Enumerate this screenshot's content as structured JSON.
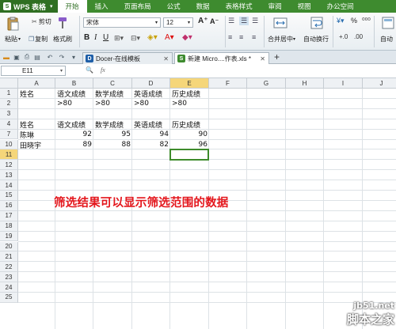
{
  "app": {
    "brand": "WPS 表格"
  },
  "menu": [
    "开始",
    "插入",
    "页面布局",
    "公式",
    "数据",
    "表格样式",
    "审阅",
    "视图",
    "办公空间"
  ],
  "ribbon": {
    "paste": "粘贴",
    "cut": "剪切",
    "copy": "复制",
    "format_painter": "格式刷",
    "font_name": "宋体",
    "font_size": "12",
    "merge_center": "合并居中",
    "wrap_text": "自动换行",
    "auto": "自动",
    "percent": "%"
  },
  "tabs": {
    "tab1": "Docer-在线模板",
    "tab2": "新建 Micro....作表.xls *"
  },
  "formula_bar": {
    "cell_ref": "E11",
    "fx": "fx",
    "zoom_icon": "🔍",
    "value": ""
  },
  "columns": [
    "A",
    "B",
    "C",
    "D",
    "E",
    "F",
    "G",
    "H",
    "I",
    "J"
  ],
  "selected_column": "E",
  "rows": [
    "1",
    "2",
    "3",
    "4",
    "7",
    "10",
    "11",
    "12",
    "13",
    "14",
    "15",
    "16",
    "17",
    "18",
    "19",
    "20",
    "21",
    "22",
    "23",
    "24",
    "25"
  ],
  "selected_row": "11",
  "cells": {
    "r1": [
      "姓名",
      "语文成绩",
      "数学成绩",
      "英语成绩",
      "历史成绩"
    ],
    "r2": [
      "",
      ">80",
      ">80",
      ">80",
      ">80"
    ],
    "r4": [
      "姓名",
      "语文成绩",
      "数学成绩",
      "英语成绩",
      "历史成绩"
    ],
    "r7": [
      "陈琳",
      "92",
      "95",
      "94",
      "90"
    ],
    "r10": [
      "田晓宇",
      "89",
      "88",
      "82",
      "96"
    ]
  },
  "annotation": "筛选结果可以显示筛选范围的数据",
  "watermark": {
    "line1": "jb51.net",
    "line2": "脚本之家"
  }
}
